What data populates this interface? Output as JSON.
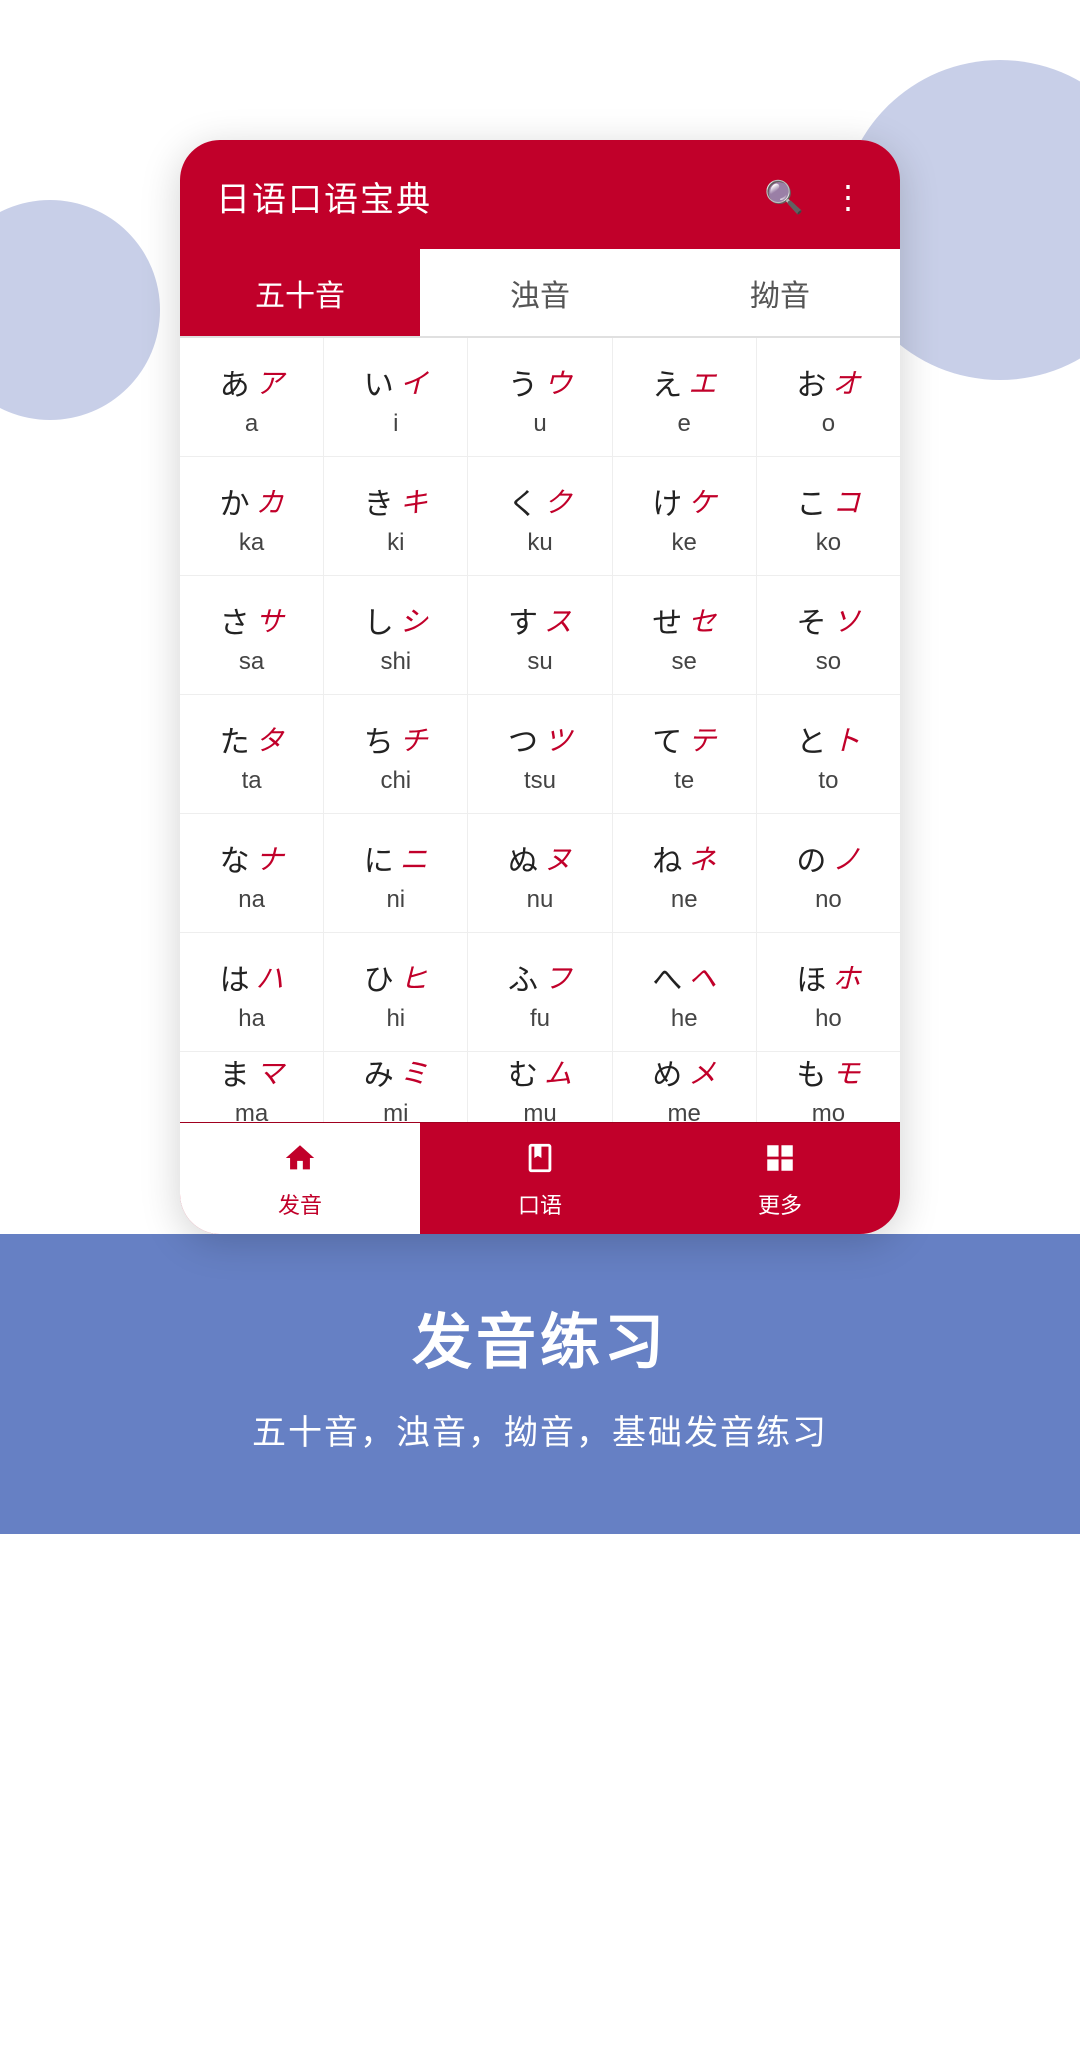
{
  "app": {
    "title": "日语口语宝典",
    "search_icon": "🔍",
    "menu_icon": "⋮"
  },
  "tabs": [
    {
      "label": "五十音",
      "active": true
    },
    {
      "label": "浊音",
      "active": false
    },
    {
      "label": "拗音",
      "active": false
    }
  ],
  "kana_rows": [
    [
      {
        "hiragana": "あ",
        "katakana": "ア",
        "romaji": "a"
      },
      {
        "hiragana": "い",
        "katakana": "イ",
        "romaji": "i"
      },
      {
        "hiragana": "う",
        "katakana": "ウ",
        "romaji": "u"
      },
      {
        "hiragana": "え",
        "katakana": "エ",
        "romaji": "e"
      },
      {
        "hiragana": "お",
        "katakana": "オ",
        "romaji": "o"
      }
    ],
    [
      {
        "hiragana": "か",
        "katakana": "カ",
        "romaji": "ka"
      },
      {
        "hiragana": "き",
        "katakana": "キ",
        "romaji": "ki"
      },
      {
        "hiragana": "く",
        "katakana": "ク",
        "romaji": "ku"
      },
      {
        "hiragana": "け",
        "katakana": "ケ",
        "romaji": "ke"
      },
      {
        "hiragana": "こ",
        "katakana": "コ",
        "romaji": "ko"
      }
    ],
    [
      {
        "hiragana": "さ",
        "katakana": "サ",
        "romaji": "sa"
      },
      {
        "hiragana": "し",
        "katakana": "シ",
        "romaji": "shi"
      },
      {
        "hiragana": "す",
        "katakana": "ス",
        "romaji": "su"
      },
      {
        "hiragana": "せ",
        "katakana": "セ",
        "romaji": "se"
      },
      {
        "hiragana": "そ",
        "katakana": "ソ",
        "romaji": "so"
      }
    ],
    [
      {
        "hiragana": "た",
        "katakana": "タ",
        "romaji": "ta"
      },
      {
        "hiragana": "ち",
        "katakana": "チ",
        "romaji": "chi"
      },
      {
        "hiragana": "つ",
        "katakana": "ツ",
        "romaji": "tsu"
      },
      {
        "hiragana": "て",
        "katakana": "テ",
        "romaji": "te"
      },
      {
        "hiragana": "と",
        "katakana": "ト",
        "romaji": "to"
      }
    ],
    [
      {
        "hiragana": "な",
        "katakana": "ナ",
        "romaji": "na"
      },
      {
        "hiragana": "に",
        "katakana": "ニ",
        "romaji": "ni"
      },
      {
        "hiragana": "ぬ",
        "katakana": "ヌ",
        "romaji": "nu"
      },
      {
        "hiragana": "ね",
        "katakana": "ネ",
        "romaji": "ne"
      },
      {
        "hiragana": "の",
        "katakana": "ノ",
        "romaji": "no"
      }
    ],
    [
      {
        "hiragana": "は",
        "katakana": "ハ",
        "romaji": "ha"
      },
      {
        "hiragana": "ひ",
        "katakana": "ヒ",
        "romaji": "hi"
      },
      {
        "hiragana": "ふ",
        "katakana": "フ",
        "romaji": "fu"
      },
      {
        "hiragana": "へ",
        "katakana": "ヘ",
        "romaji": "he"
      },
      {
        "hiragana": "ほ",
        "katakana": "ホ",
        "romaji": "ho"
      }
    ],
    [
      {
        "hiragana": "ま",
        "katakana": "マ",
        "romaji": "ma"
      },
      {
        "hiragana": "み",
        "katakana": "ミ",
        "romaji": "mi"
      },
      {
        "hiragana": "む",
        "katakana": "ム",
        "romaji": "mu"
      },
      {
        "hiragana": "め",
        "katakana": "メ",
        "romaji": "me"
      },
      {
        "hiragana": "も",
        "katakana": "モ",
        "romaji": "mo"
      }
    ]
  ],
  "bottom_nav": [
    {
      "icon": "🏠",
      "label": "发音",
      "active": true
    },
    {
      "icon": "📖",
      "label": "口语",
      "active": false
    },
    {
      "icon": "⊞",
      "label": "更多",
      "active": false
    }
  ],
  "promo": {
    "title": "发音练习",
    "subtitle": "五十音，浊音，拗音，基础发音练习"
  }
}
